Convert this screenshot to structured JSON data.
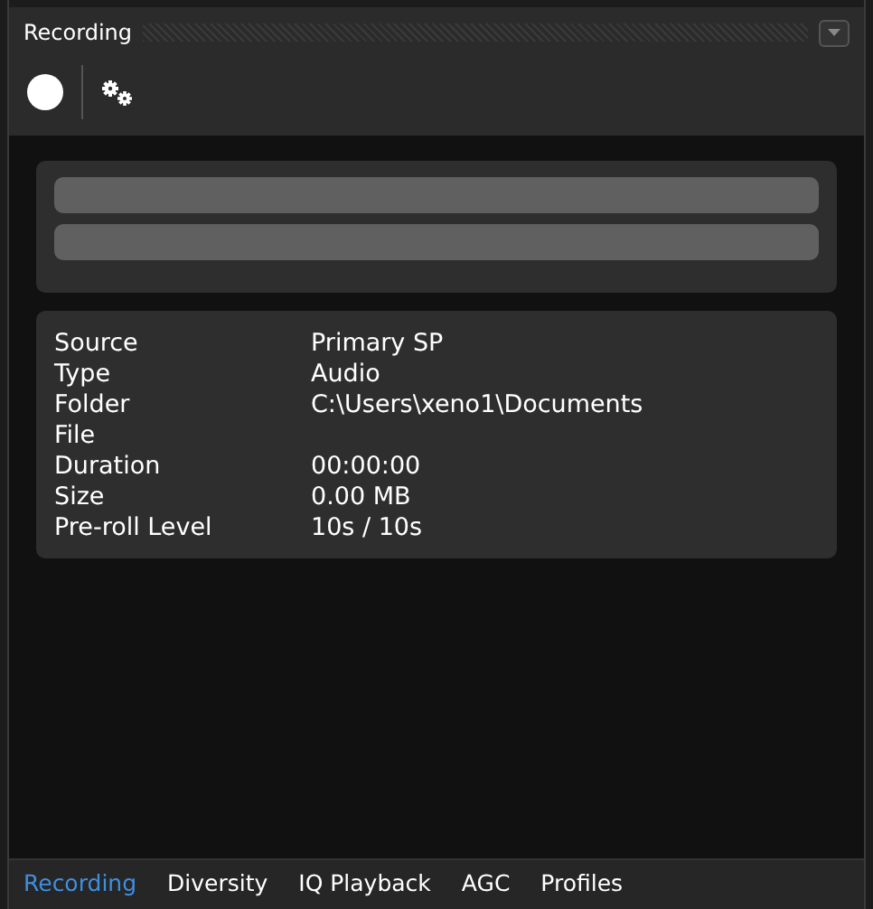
{
  "panel": {
    "title": "Recording"
  },
  "toolbar": {
    "record_button": {
      "on": false
    }
  },
  "meters": [
    {
      "level": 0
    },
    {
      "level": 0
    }
  ],
  "info": [
    {
      "label": "Source",
      "value": "Primary SP"
    },
    {
      "label": "Type",
      "value": "Audio"
    },
    {
      "label": "Folder",
      "value": "C:\\Users\\xeno1\\Documents"
    },
    {
      "label": "File"
    },
    {
      "label": "Duration",
      "value": "00:00:00"
    },
    {
      "label": "Size",
      "value": "0.00 MB"
    },
    {
      "label": "Pre-roll Level",
      "value": "10s / 10s"
    }
  ],
  "tabs": [
    {
      "label": "Recording",
      "selected": true
    },
    {
      "label": "Diversity",
      "selected": false
    },
    {
      "label": "IQ Playback",
      "selected": false
    },
    {
      "label": "AGC",
      "selected": false
    },
    {
      "label": "Profiles",
      "selected": false
    }
  ]
}
